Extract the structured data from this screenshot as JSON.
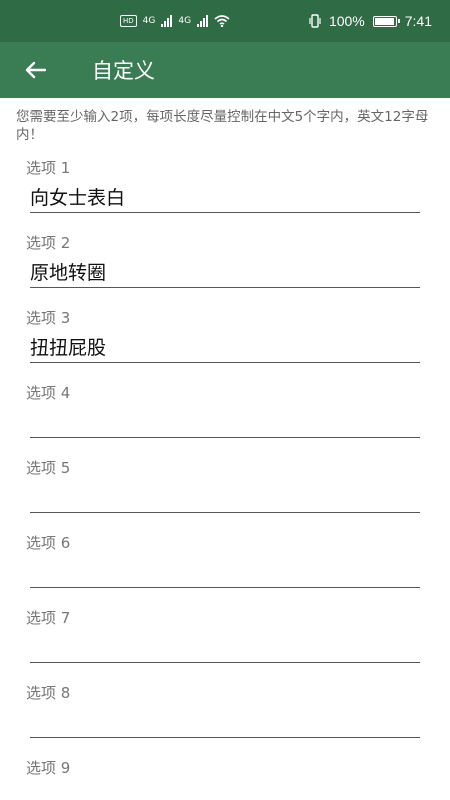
{
  "status_bar": {
    "network_1": "4G",
    "network_2": "4G",
    "battery": "100%",
    "time": "7:41"
  },
  "header": {
    "title": "自定义"
  },
  "hint": "您需要至少输入2项，每项长度尽量控制在中文5个字内，英文12字母内！",
  "options": [
    {
      "label": "选项 1",
      "value": "向女士表白"
    },
    {
      "label": "选项 2",
      "value": "原地转圈"
    },
    {
      "label": "选项 3",
      "value": "扭扭屁股"
    },
    {
      "label": "选项 4",
      "value": ""
    },
    {
      "label": "选项 5",
      "value": ""
    },
    {
      "label": "选项 6",
      "value": ""
    },
    {
      "label": "选项 7",
      "value": ""
    },
    {
      "label": "选项 8",
      "value": ""
    },
    {
      "label": "选项 9",
      "value": ""
    }
  ],
  "colors": {
    "status_bar": "#2f6b45",
    "app_bar": "#3a7d54"
  }
}
